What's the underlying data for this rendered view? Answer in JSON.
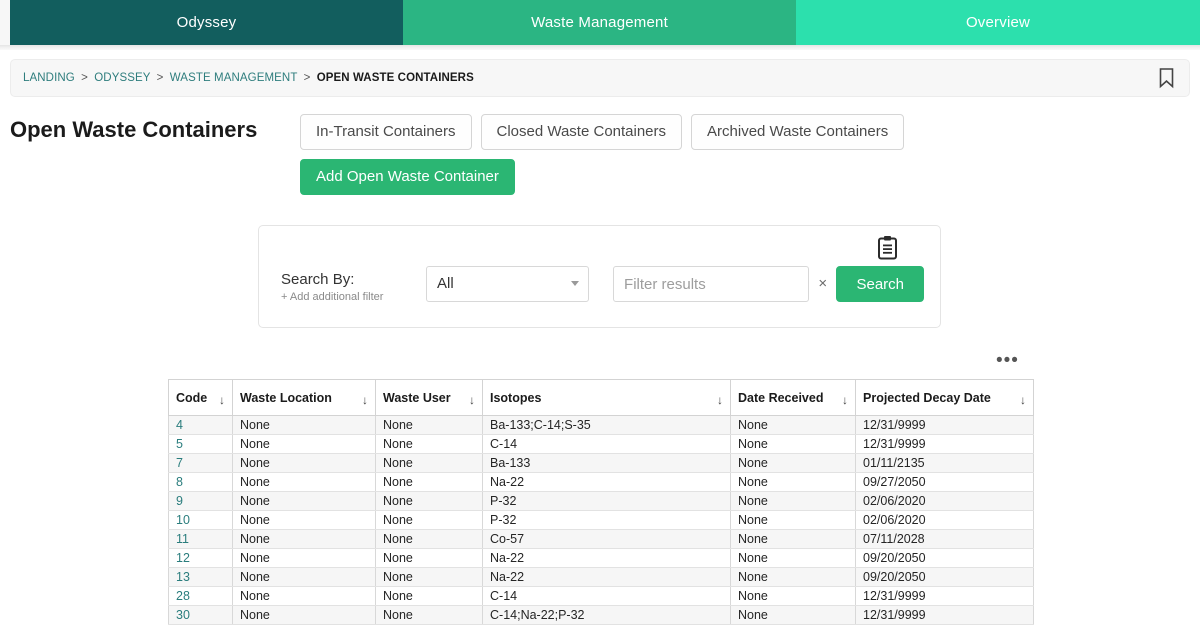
{
  "theme": {
    "tab_active": "#125e5e",
    "tab_mid": "#2bb583",
    "tab_light": "#2ce0ad",
    "primary_green": "#2bb673",
    "link_teal": "#2a7d7d"
  },
  "tabs": [
    {
      "label": "Odyssey"
    },
    {
      "label": "Waste Management"
    },
    {
      "label": "Overview"
    }
  ],
  "breadcrumb": {
    "items": [
      {
        "label": "LANDING",
        "current": false
      },
      {
        "label": "ODYSSEY",
        "current": false
      },
      {
        "label": "WASTE MANAGEMENT",
        "current": false
      },
      {
        "label": "OPEN WASTE CONTAINERS",
        "current": true
      }
    ],
    "separator": ">",
    "bookmark_icon": "bookmark-icon"
  },
  "page": {
    "title": "Open Waste Containers",
    "actions": [
      {
        "label": "In-Transit Containers"
      },
      {
        "label": "Closed Waste Containers"
      },
      {
        "label": "Archived Waste Containers"
      }
    ],
    "primary_action": {
      "label": "Add Open Waste Container"
    }
  },
  "search": {
    "label": "Search By:",
    "add_filter": "+ Add additional filter",
    "select_value": "All",
    "select_options": [
      "All"
    ],
    "filter_value": "",
    "filter_placeholder": "Filter results",
    "clear_label": "×",
    "search_button": "Search",
    "clipboard_icon": "clipboard-icon",
    "dropdown_icon": "chevron-down-icon"
  },
  "toolbar": {
    "more_label": "•••",
    "more_icon": "ellipsis-icon"
  },
  "table": {
    "sort_icon": "↓",
    "columns": [
      {
        "label": "Code",
        "sortable": true
      },
      {
        "label": "Waste Location",
        "sortable": true
      },
      {
        "label": "Waste User",
        "sortable": true
      },
      {
        "label": "Isotopes",
        "sortable": true
      },
      {
        "label": "Date Received",
        "sortable": true
      },
      {
        "label": "Projected Decay Date",
        "sortable": true
      }
    ],
    "rows": [
      {
        "code": "4",
        "waste_location": "None",
        "waste_user": "None",
        "isotopes": "Ba-133;C-14;S-35",
        "date_received": "None",
        "projected_decay_date": "12/31/9999"
      },
      {
        "code": "5",
        "waste_location": "None",
        "waste_user": "None",
        "isotopes": "C-14",
        "date_received": "None",
        "projected_decay_date": "12/31/9999"
      },
      {
        "code": "7",
        "waste_location": "None",
        "waste_user": "None",
        "isotopes": "Ba-133",
        "date_received": "None",
        "projected_decay_date": "01/11/2135"
      },
      {
        "code": "8",
        "waste_location": "None",
        "waste_user": "None",
        "isotopes": "Na-22",
        "date_received": "None",
        "projected_decay_date": "09/27/2050"
      },
      {
        "code": "9",
        "waste_location": "None",
        "waste_user": "None",
        "isotopes": "P-32",
        "date_received": "None",
        "projected_decay_date": "02/06/2020"
      },
      {
        "code": "10",
        "waste_location": "None",
        "waste_user": "None",
        "isotopes": "P-32",
        "date_received": "None",
        "projected_decay_date": "02/06/2020"
      },
      {
        "code": "11",
        "waste_location": "None",
        "waste_user": "None",
        "isotopes": "Co-57",
        "date_received": "None",
        "projected_decay_date": "07/11/2028"
      },
      {
        "code": "12",
        "waste_location": "None",
        "waste_user": "None",
        "isotopes": "Na-22",
        "date_received": "None",
        "projected_decay_date": "09/20/2050"
      },
      {
        "code": "13",
        "waste_location": "None",
        "waste_user": "None",
        "isotopes": "Na-22",
        "date_received": "None",
        "projected_decay_date": "09/20/2050"
      },
      {
        "code": "28",
        "waste_location": "None",
        "waste_user": "None",
        "isotopes": "C-14",
        "date_received": "None",
        "projected_decay_date": "12/31/9999"
      },
      {
        "code": "30",
        "waste_location": "None",
        "waste_user": "None",
        "isotopes": "C-14;Na-22;P-32",
        "date_received": "None",
        "projected_decay_date": "12/31/9999"
      }
    ]
  }
}
